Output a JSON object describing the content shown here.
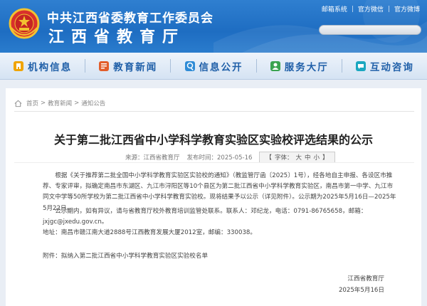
{
  "header": {
    "org_name": "中共江西省委教育工作委员会",
    "dept_name": "江西省教育厅",
    "links": [
      "邮箱系统",
      "官方微信",
      "官方微博"
    ],
    "colors": {
      "primary": "#1e6dc2",
      "nav_text": "#1f5fa8"
    }
  },
  "nav": {
    "items": [
      {
        "label": "机构信息",
        "icon": "building-icon"
      },
      {
        "label": "教育新闻",
        "icon": "news-icon"
      },
      {
        "label": "信息公开",
        "icon": "info-icon"
      },
      {
        "label": "服务大厅",
        "icon": "service-icon"
      },
      {
        "label": "互动咨询",
        "icon": "chat-icon"
      }
    ]
  },
  "breadcrumb": {
    "items": [
      "首页",
      "教育新闻",
      "通知公告"
    ]
  },
  "article": {
    "title": "关于第二批江西省中小学科学教育实验区实验校评选结果的公示",
    "source_label": "来源：江西省教育厅",
    "date_label": "发布时间：2025-05-16",
    "font_size_label": "字体：",
    "font_sizes": [
      "大",
      "中",
      "小"
    ],
    "paragraphs": [
      "根据《关于推荐第二批全国中小学科学教育实验区实验校的通知》（教监管厅函〔2025〕1号），经各地自主申报、各设区市推荐、专家评审，拟确定南昌市东湖区、九江市浔阳区等10个县区为第二批江西省中小学科学教育实验区，南昌市第一中学、九江市同文中学等50所学校为第二批江西省中小学科学教育实验校。现将结果予以公示（详见附件）。公示期为2025年5月16日—2025年5月22日。",
      "公示期内，如有异议，请与省教育厅校外教育培训监管处联系。联系人：邓纪龙，电话：0791-86765658，邮箱：jxjgc@jxedu.gov.cn。",
      "地址：南昌市赣江南大道2888号江西教育发展大厦2012室，邮编：330038。",
      "附件：拟纳入第二批江西省中小学科学教育实验区实验校名单"
    ],
    "signature": "江西省教育厅",
    "signature_date": "2025年5月16日"
  }
}
